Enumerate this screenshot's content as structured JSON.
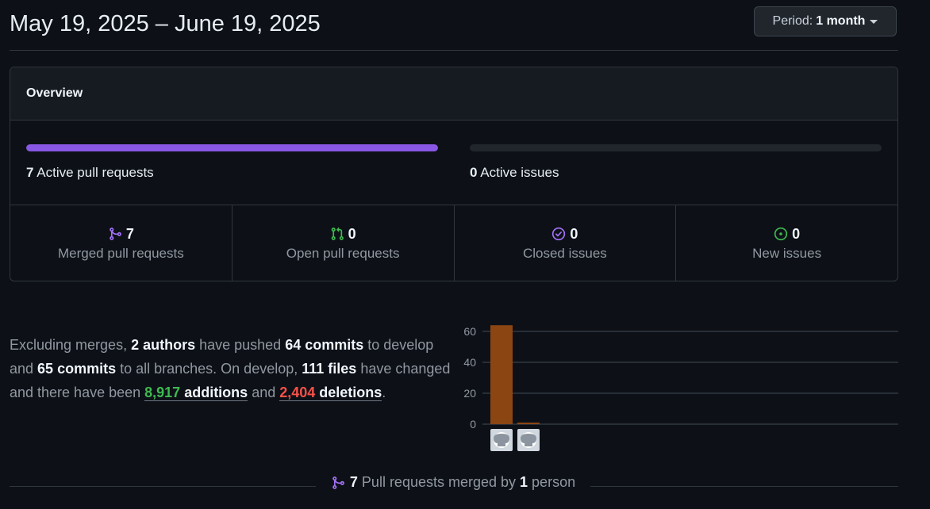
{
  "header": {
    "title": "May 19, 2025 – June 19, 2025",
    "period_prefix": "Period:",
    "period_value": "1 month"
  },
  "overview": {
    "title": "Overview",
    "active_prs": {
      "count": "7",
      "label": "Active pull requests",
      "fill_fraction": 1.0,
      "color": "#8957e5"
    },
    "active_issues": {
      "count": "0",
      "label": "Active issues",
      "fill_fraction": 0.0
    },
    "stats": [
      {
        "icon": "git-merge-icon",
        "count": "7",
        "label": "Merged pull requests",
        "color": "#a371f7"
      },
      {
        "icon": "git-pull-request-icon",
        "count": "0",
        "label": "Open pull requests",
        "color": "#3fb950"
      },
      {
        "icon": "issue-closed-icon",
        "count": "0",
        "label": "Closed issues",
        "color": "#a371f7"
      },
      {
        "icon": "issue-opened-icon",
        "count": "0",
        "label": "New issues",
        "color": "#3fb950"
      }
    ]
  },
  "summary": {
    "t1": "Excluding merges, ",
    "authors": "2 authors",
    "t2": " have pushed ",
    "commits_develop": "64 commits",
    "t3": " to develop and ",
    "commits_all": "65 commits",
    "t4": " to all branches. On develop, ",
    "files": "111 files",
    "t5": " have changed and there have been ",
    "additions_num": "8,917",
    "additions_word": " additions",
    "t6": " and ",
    "deletions_num": "2,404",
    "deletions_word": " deletions",
    "t7": "."
  },
  "chart_data": {
    "type": "bar",
    "categories": [
      "author-1",
      "author-2"
    ],
    "values": [
      64,
      1
    ],
    "yticks": [
      0,
      20,
      40,
      60
    ],
    "ylim": [
      0,
      65
    ],
    "bar_color": "#8b4513",
    "avatar_icon": "github-icon"
  },
  "footer": {
    "icon": "git-merge-icon",
    "count": "7",
    "t1": " Pull requests merged by ",
    "people": "1",
    "t2": " person"
  }
}
